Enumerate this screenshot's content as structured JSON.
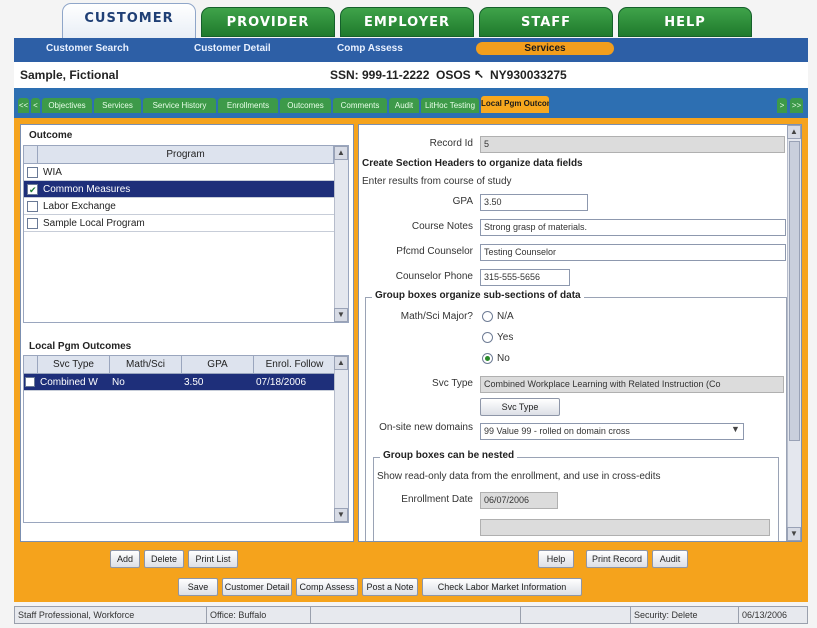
{
  "top_tabs": [
    "CUSTOMER",
    "PROVIDER",
    "EMPLOYER",
    "STAFF",
    "HELP"
  ],
  "sub_nav": [
    "Customer Search",
    "Customer Detail",
    "Comp Assess",
    "Services"
  ],
  "info": {
    "name": "Sample, Fictional",
    "ssn": "SSN: 999-11-2222",
    "osos": "OSOS",
    "osos_id": "NY930033275"
  },
  "program_tabs": {
    "prev_all": "<<",
    "prev": "<",
    "items": [
      "Objectives",
      "Services",
      "Service History",
      "Enrollments",
      "Outcomes",
      "Comments",
      "Audit",
      "LitHoc Testing",
      "Local Pgm Outcomes"
    ],
    "next": ">",
    "next_all": ">>"
  },
  "outcome_panel": {
    "title": "Outcome",
    "header": "Program",
    "rows": [
      {
        "label": "WIA",
        "checked": false
      },
      {
        "label": "Common Measures",
        "checked": true
      },
      {
        "label": "Labor Exchange",
        "checked": false
      },
      {
        "label": "Sample Local Program",
        "checked": false
      }
    ]
  },
  "local_outcomes": {
    "title": "Local Pgm Outcomes",
    "headers": [
      "Svc Type",
      "Math/Sci",
      "GPA",
      "Enrol. Follow"
    ],
    "rows": [
      [
        "Combined W",
        "No",
        "3.50",
        "07/18/2006"
      ]
    ]
  },
  "left_buttons": [
    "Add",
    "Delete",
    "Print List"
  ],
  "form": {
    "record_label": "Record Id",
    "record_value": "5",
    "section_header": "Create Section Headers to organize data fields",
    "instructions": "Enter results from course of study",
    "gpa_label": "GPA",
    "gpa_value": "3.50",
    "notes_label": "Course Notes",
    "notes_value": "Strong grasp of materials.",
    "counselor_label": "Pfcmd Counselor",
    "counselor_value": "Testing Counselor",
    "phone_label": "Counselor Phone",
    "phone_value": "315-555-5656",
    "group1_title": "Group boxes organize sub-sections of data",
    "major_label": "Math/Sci Major?",
    "radio_options": [
      "N/A",
      "Yes",
      "No"
    ],
    "radio_selected": "No",
    "svc_label": "Svc Type",
    "svc_value": "Combined Workplace Learning with Related Instruction (Co",
    "svc_button": "Svc Type",
    "onsite_label": "On-site new domains",
    "onsite_value": "99 Value 99 - rolled on domain cross",
    "group2_title": "Group boxes can be nested",
    "group2_text": "Show read-only data from the enrollment, and use in cross-edits",
    "enroll_label": "Enrollment Date",
    "enroll_value": "06/07/2006"
  },
  "right_buttons": [
    "Help",
    "Print Record",
    "Audit"
  ],
  "bottom_buttons": [
    "Save",
    "Customer Detail",
    "Comp Assess",
    "Post a Note",
    "Check Labor Market Information"
  ],
  "status": {
    "user": "Staff Professional, Workforce",
    "office": "Office: Buffalo",
    "security": "Security: Delete",
    "date": "06/13/2006"
  },
  "colors": {
    "top_tab_green": "#2e8c3b",
    "nav_blue": "#2d5fa6",
    "accent_orange": "#f5a31c",
    "selected_row": "#1e2f7a"
  }
}
